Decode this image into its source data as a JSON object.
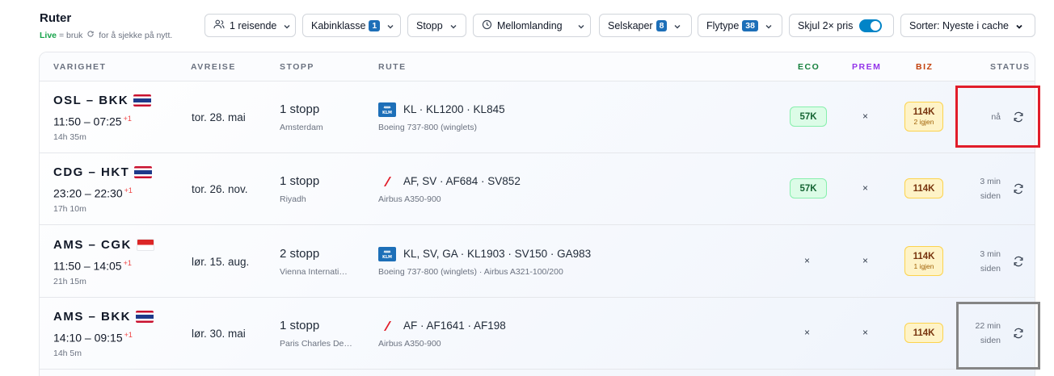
{
  "header": {
    "title": "Ruter",
    "live_label": "Live",
    "live_hint_before": "= bruk",
    "live_hint_after": "for å sjekke på nytt."
  },
  "filters": {
    "travelers": "1 reisende",
    "cabin": "Kabinklasse",
    "cabin_count": "1",
    "stops": "Stopp",
    "layover": "Mellomlanding",
    "airlines": "Selskaper",
    "airlines_count": "8",
    "aircraft": "Flytype",
    "aircraft_count": "38",
    "hide_double": "Skjul 2× pris",
    "sort": "Sorter: Nyeste i cache"
  },
  "columns": {
    "duration": "VARIGHET",
    "departure": "AVREISE",
    "stops": "STOPP",
    "route": "RUTE",
    "eco": "ECO",
    "prem": "PREM",
    "biz": "BIZ",
    "status": "STATUS"
  },
  "colors": {
    "eco": "#15803d",
    "prem": "#9333ea",
    "biz": "#c2410c",
    "accent": "#0284c7",
    "highlight_red": "#e11d2a",
    "highlight_gray": "#858585"
  },
  "rows": [
    {
      "route": "OSL – BKK",
      "flag": "thailand-flag",
      "times": "11:50 – 07:25",
      "day_offset": "+1",
      "duration": "14h 35m",
      "date": "tor. 28. mai",
      "stops": "1 stopp",
      "via": "Amsterdam",
      "airline_logo": "klm-logo",
      "flights": "KL · KL1200 · KL845",
      "aircraft": "Boeing 737-800 (winglets)",
      "eco": "57K",
      "prem": "×",
      "biz": "114K",
      "biz_left": "2 igjen",
      "status": "nå"
    },
    {
      "route": "CDG – HKT",
      "flag": "thailand-flag",
      "times": "23:20 – 22:30",
      "day_offset": "+1",
      "duration": "17h 10m",
      "date": "tor. 26. nov.",
      "stops": "1 stopp",
      "via": "Riyadh",
      "airline_logo": "air-france-logo",
      "flights": "AF, SV · AF684 · SV852",
      "aircraft": "Airbus A350-900",
      "eco": "57K",
      "prem": "×",
      "biz": "114K",
      "status_line1": "3 min",
      "status_line2": "siden"
    },
    {
      "route": "AMS – CGK",
      "flag": "indonesia-flag",
      "times": "11:50 – 14:05",
      "day_offset": "+1",
      "duration": "21h 15m",
      "date": "lør. 15. aug.",
      "stops": "2 stopp",
      "via": "Vienna Internati…",
      "airline_logo": "klm-logo",
      "flights": "KL, SV, GA · KL1903 · SV150 · GA983",
      "aircraft": "Boeing 737-800 (winglets) · Airbus A321-100/200",
      "eco": "×",
      "prem": "×",
      "biz": "114K",
      "biz_left": "1 igjen",
      "status_line1": "3 min",
      "status_line2": "siden"
    },
    {
      "route": "AMS – BKK",
      "flag": "thailand-flag",
      "times": "14:10 – 09:15",
      "day_offset": "+1",
      "duration": "14h 5m",
      "date": "lør. 30. mai",
      "stops": "1 stopp",
      "via": "Paris Charles De…",
      "airline_logo": "air-france-logo",
      "flights": "AF · AF1641 · AF198",
      "aircraft": "Airbus A350-900",
      "eco": "×",
      "prem": "×",
      "biz": "114K",
      "status_line1": "22 min",
      "status_line2": "siden"
    }
  ]
}
